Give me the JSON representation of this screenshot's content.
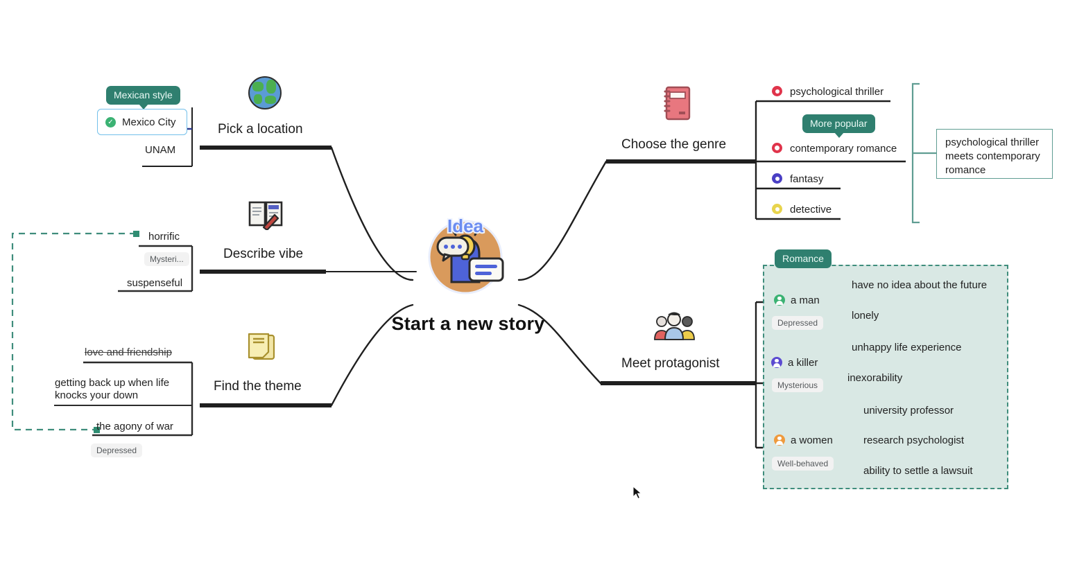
{
  "center": {
    "title": "Start a new story",
    "badge_text": "Idea",
    "badge_icon": "idea-lightbulb-person-illustration"
  },
  "branches": [
    {
      "id": "pick-a-location",
      "title": "Pick a location",
      "icon": "globe-icon",
      "tag": "Mexican style",
      "items": [
        {
          "label": "Mexico City",
          "selected": true,
          "icon": "green-check-icon"
        },
        {
          "label": "UNAM",
          "selected": false
        }
      ]
    },
    {
      "id": "describe-vibe",
      "title": "Describe vibe",
      "icon": "open-book-pencil-icon",
      "pill": "Mysteri...",
      "items": [
        {
          "label": "horrific"
        },
        {
          "label": "suspenseful"
        }
      ]
    },
    {
      "id": "find-the-theme",
      "title": "Find the theme",
      "icon": "sticky-notes-icon",
      "pill": "Depressed",
      "items": [
        {
          "label": "love and friendship",
          "struck": true
        },
        {
          "label": "getting back up when life knocks your down"
        },
        {
          "label": "the agony of war"
        }
      ]
    },
    {
      "id": "choose-the-genre",
      "title": "Choose the genre",
      "icon": "notebook-icon",
      "tag": "More popular",
      "items": [
        {
          "label": "psychological thriller",
          "color": "#e0344b",
          "icon": "star-badge-icon"
        },
        {
          "label": "contemporary romance",
          "color": "#e0344b",
          "icon": "heart-badge-icon"
        },
        {
          "label": "fantasy",
          "color": "#4a3fc4",
          "icon": "fantasy-badge-icon"
        },
        {
          "label": "detective",
          "color": "#e8d44d",
          "icon": "lightbulb-badge-icon"
        }
      ],
      "result": "psychological thriller meets contemporary romance"
    },
    {
      "id": "meet-protagonist",
      "title": "Meet protagonist",
      "icon": "people-group-icon",
      "tag": "Romance",
      "characters": [
        {
          "label": "a man",
          "color": "#3bb273",
          "icon": "avatar-icon",
          "pill": "Depressed",
          "traits": [
            "have no idea about the future",
            "lonely"
          ]
        },
        {
          "label": "a killer",
          "color": "#5b4bd1",
          "icon": "avatar-icon",
          "pill": "Mysterious",
          "traits": [
            "unhappy life experience",
            "inexorability"
          ]
        },
        {
          "label": "a women",
          "color": "#ef9a3d",
          "icon": "avatar-icon",
          "pill": "Well-behaved",
          "traits": [
            "university professor",
            "research psychologist",
            "ability to settle a lawsuit"
          ]
        }
      ]
    }
  ],
  "colors": {
    "teal": "#2f7f6f",
    "teal_border": "#3f8d7c",
    "group_fill": "#d9e8e4",
    "select_blue": "#73c0ea",
    "line": "#1f1f1f"
  },
  "cursor": {
    "icon": "mouse-arrow-cursor"
  }
}
